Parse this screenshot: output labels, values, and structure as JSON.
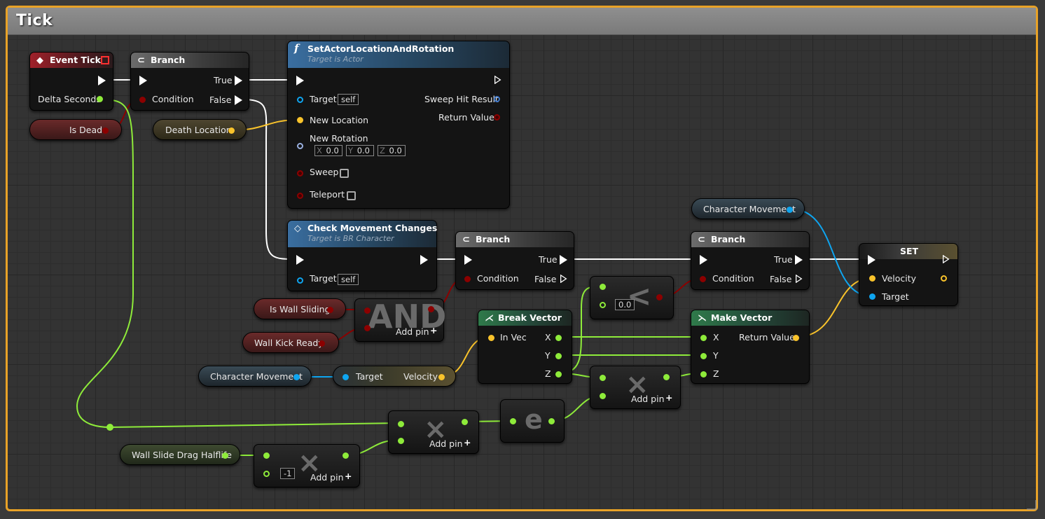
{
  "comment": {
    "title": "Tick"
  },
  "event_tick": {
    "title": "Event Tick",
    "delta_label": "Delta Seconds"
  },
  "branch1": {
    "title": "Branch",
    "true_label": "True",
    "false_label": "False",
    "condition_label": "Condition"
  },
  "is_dead": {
    "label": "Is Dead"
  },
  "death_location": {
    "label": "Death Location"
  },
  "set_actor": {
    "title": "SetActorLocationAndRotation",
    "subtitle": "Target is Actor",
    "target_label": "Target",
    "target_default": "self",
    "new_location_label": "New Location",
    "new_rotation_label": "New Rotation",
    "rot_x_axis": "X",
    "rot_x": "0.0",
    "rot_y_axis": "Y",
    "rot_y": "0.0",
    "rot_z_axis": "Z",
    "rot_z": "0.0",
    "sweep_label": "Sweep",
    "teleport_label": "Teleport",
    "sweep_hit_label": "Sweep Hit Result",
    "return_label": "Return Value"
  },
  "check_movement": {
    "title": "Check Movement Changes",
    "subtitle": "Target is BR Character",
    "target_label": "Target",
    "target_default": "self"
  },
  "branch2": {
    "title": "Branch",
    "true_label": "True",
    "false_label": "False",
    "condition_label": "Condition"
  },
  "branch3": {
    "title": "Branch",
    "true_label": "True",
    "false_label": "False",
    "condition_label": "Condition"
  },
  "char_movement_top": {
    "label": "Character Movement"
  },
  "set_node": {
    "title": "SET",
    "velocity_label": "Velocity",
    "target_label": "Target"
  },
  "is_wall_sliding": {
    "label": "Is Wall Sliding"
  },
  "wall_kick_ready": {
    "label": "Wall Kick Ready"
  },
  "and_node": {
    "symbol": "AND",
    "add_pin_label": "Add pin"
  },
  "char_movement_bottom": {
    "label": "Character Movement"
  },
  "get_velocity": {
    "target_label": "Target",
    "velocity_label": "Velocity"
  },
  "break_vector": {
    "title": "Break Vector",
    "in_label": "In Vec",
    "x_label": "X",
    "y_label": "Y",
    "z_label": "Z"
  },
  "less_node": {
    "symbol": "<",
    "value": "0.0"
  },
  "make_vector": {
    "title": "Make Vector",
    "x_label": "X",
    "y_label": "Y",
    "z_label": "Z",
    "return_label": "Return Value"
  },
  "mult_z": {
    "symbol": "×",
    "add_pin_label": "Add pin"
  },
  "exp_node": {
    "symbol": "e"
  },
  "mult_dt": {
    "symbol": "×",
    "add_pin_label": "Add pin"
  },
  "wall_slide_drag": {
    "label": "Wall Slide Drag Halflife"
  },
  "mult_neg": {
    "symbol": "×",
    "value": "-1",
    "add_pin_label": "Add pin"
  },
  "colors": {
    "comment_border": "#e8a227",
    "exec": "#ffffff",
    "bool": "#8c0000",
    "vector": "#f9c32b",
    "float": "#8eeb3a",
    "object": "#0ea5f0",
    "struct": "#3b73c4"
  }
}
